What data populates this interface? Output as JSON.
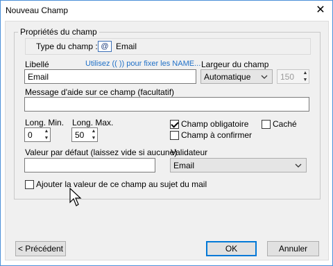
{
  "window": {
    "title": "Nouveau Champ"
  },
  "group": {
    "title": "Propriétés du champ"
  },
  "type_row": {
    "label": "Type du champ :",
    "icon_text": "@",
    "value": "Email"
  },
  "libelle": {
    "label": "Libellé",
    "value": "Email",
    "help_link": "Utilisez (( )) pour fixer les NAME..."
  },
  "largeur": {
    "label": "Largeur du champ",
    "selected": "Automatique",
    "number": "150"
  },
  "aide": {
    "label": "Message d'aide sur ce champ (facultatif)",
    "value": ""
  },
  "long_min": {
    "label": "Long. Min.",
    "value": "0"
  },
  "long_max": {
    "label": "Long. Max.",
    "value": "50"
  },
  "checkboxes": {
    "obligatoire": {
      "label": "Champ obligatoire",
      "checked": true
    },
    "cache": {
      "label": "Caché",
      "checked": false
    },
    "confirmer": {
      "label": "Champ à confirmer",
      "checked": false
    },
    "sujet": {
      "label": "Ajouter la valeur de ce champ au sujet du mail",
      "checked": false
    }
  },
  "defaut": {
    "label": "Valeur par défaut (laissez vide si aucune)",
    "value": ""
  },
  "validateur": {
    "label": "Validateur",
    "selected": "Email"
  },
  "buttons": {
    "previous": "< Précédent",
    "ok": "OK",
    "cancel": "Annuler"
  },
  "icons": {
    "close": "close-icon",
    "chevron": "chevron-down-icon",
    "cursor": "mouse-pointer-icon"
  }
}
